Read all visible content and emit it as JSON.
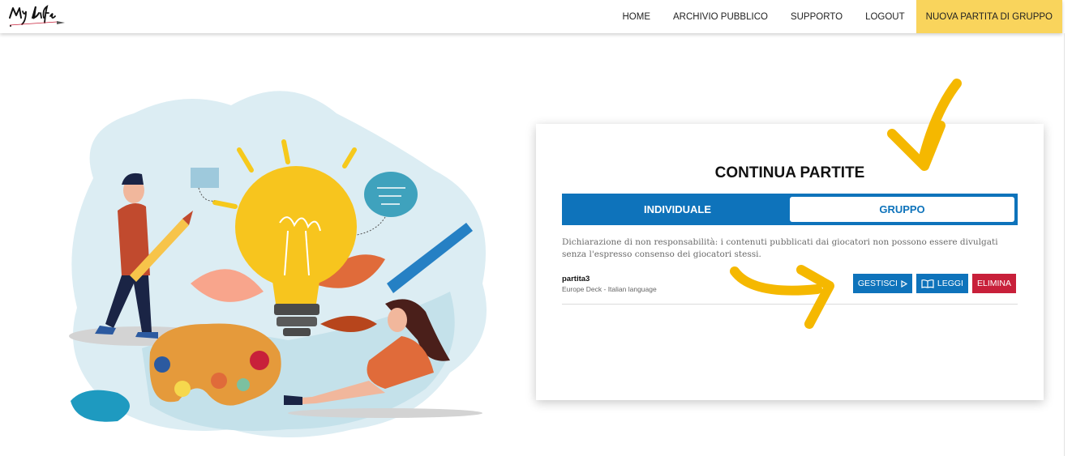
{
  "nav": {
    "logo_text": "My Life",
    "items": [
      "HOME",
      "ARCHIVIO PUBBLICO",
      "SUPPORTO",
      "LOGOUT"
    ],
    "cta": "NUOVA PARTITA DI GRUPPO"
  },
  "card": {
    "title": "CONTINUA PARTITE",
    "tabs": {
      "individual": "INDIVIDUALE",
      "group": "GRUPPO"
    },
    "disclaimer": "Dichiarazione di non responsabilità: i contenuti pubblicati dai giocatori non possono essere divulgati senza l'espresso consenso dei giocatori stessi.",
    "games": [
      {
        "name": "partita3",
        "deck": "Europe Deck - Italian language",
        "manage_label": "GESTISCI",
        "read_label": "LEGGI",
        "delete_label": "ELIMINA"
      }
    ]
  },
  "colors": {
    "primary": "#0e73bb",
    "accent": "#f9d45c",
    "danger": "#c8203a",
    "arrow": "#f5b800"
  }
}
